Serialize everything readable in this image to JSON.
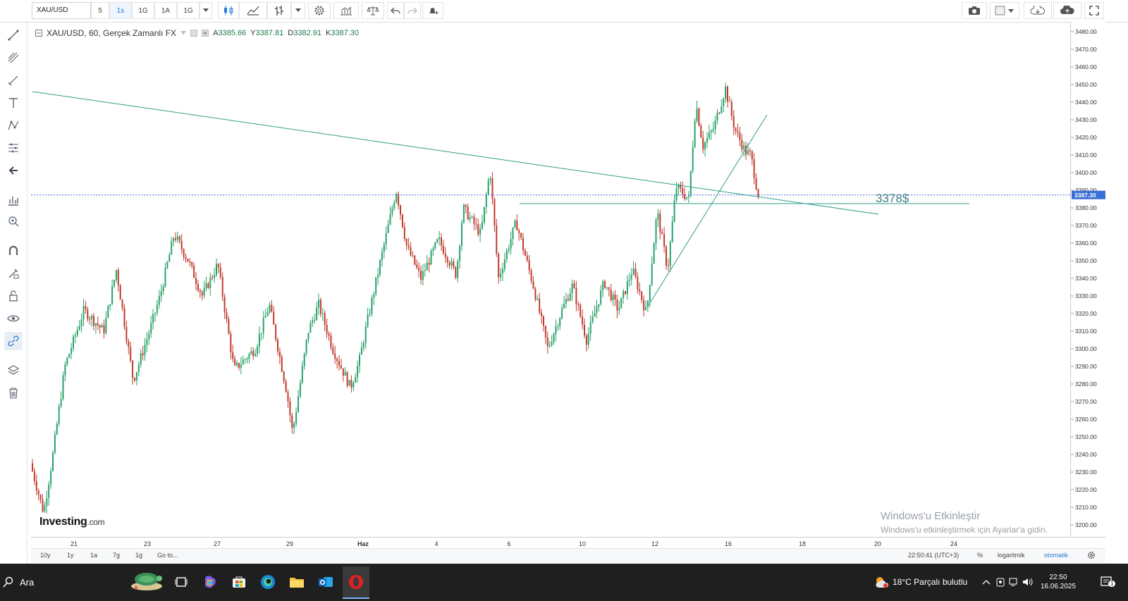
{
  "toolbar": {
    "symbol": "XAU/USD",
    "timeframes": [
      "5",
      "1s",
      "1G",
      "1A",
      "1G"
    ],
    "active_timeframe_index": 1
  },
  "legend": {
    "title": "XAU/USD, 60, Gerçek Zamanlı FX",
    "open_label": "A",
    "open": "3385.66",
    "high_label": "Y",
    "high": "3387.81",
    "low_label": "D",
    "low": "3382.91",
    "close_label": "K",
    "close": "3387.30"
  },
  "annotation": {
    "text": "3378$"
  },
  "price_axis": {
    "ticks": [
      "3480.00",
      "3470.00",
      "3460.00",
      "3450.00",
      "3440.00",
      "3430.00",
      "3420.00",
      "3410.00",
      "3400.00",
      "3390.00",
      "3380.00",
      "3370.00",
      "3360.00",
      "3350.00",
      "3340.00",
      "3330.00",
      "3320.00",
      "3310.00",
      "3300.00",
      "3290.00",
      "3280.00",
      "3270.00",
      "3260.00",
      "3250.00",
      "3240.00",
      "3230.00",
      "3220.00",
      "3210.00",
      "3200.00"
    ],
    "current_price": "3387.30"
  },
  "time_axis": {
    "labels": [
      "21",
      "23",
      "27",
      "29",
      "Haz",
      "4",
      "6",
      "10",
      "12",
      "16",
      "18",
      "20",
      "24"
    ]
  },
  "bottom_bar": {
    "ranges": [
      "10y",
      "1y",
      "1a",
      "7g",
      "1g",
      "Go to..."
    ],
    "clock": "22:50:41 (UTC+3)",
    "percent": "%",
    "log": "logaritmik",
    "auto": "otomatik"
  },
  "brand": {
    "name": "Investing",
    "suffix": ".com"
  },
  "watermark": {
    "title": "Windows'u Etkinleştir",
    "subtitle": "Windows'u etkinleştirmek için Ayarlar'a gidin."
  },
  "taskbar": {
    "search_placeholder": "Ara",
    "weather": "18°C  Parçalı bulutlu",
    "time": "22:50",
    "date": "16.06.2025",
    "notification_count": "1"
  },
  "colors": {
    "bull": "#26a269",
    "bear": "#c0392b",
    "trendline": "#2f9e8a",
    "accent": "#2a7bd4",
    "price_label_bg": "#3b6fd8"
  }
}
